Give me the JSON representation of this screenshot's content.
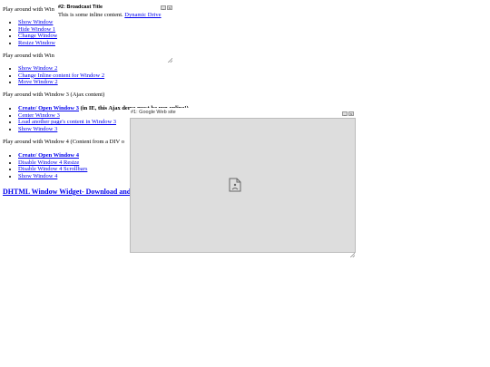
{
  "section1": {
    "text": "Play around with Win",
    "links": [
      "Show Window",
      "Hide Window 1",
      "Change Window",
      "Resize Window"
    ]
  },
  "section2": {
    "text": "Play around with Win",
    "links": [
      "Show Window 2",
      "Change Inline content for Window 2",
      "Move Window 2"
    ]
  },
  "section3": {
    "text": "Play around with Window 3 (Ajax content)",
    "first_link": "Create/ Open Window 3",
    "first_suffix": " (in IE, this Ajax demo must be run online!)",
    "links": [
      "Center Window 3",
      "Load another page's content in Window 3",
      "Show Window 3"
    ]
  },
  "section4": {
    "text": "Play around with Window 4 (Content from a DIV o",
    "links": [
      "Create/ Open Window 4",
      "Disable Window 4 Resize",
      "Disable Window 4 Scrollbars",
      "Show Window 4"
    ]
  },
  "footer_heading": "DHTML Window Widget- Download and",
  "window2": {
    "title": "#2: Broadcast Title",
    "body_text": "This is some inline content.",
    "body_link": "Dynamic Drive"
  },
  "window1": {
    "title": "#1: Google Web site"
  },
  "icons": {
    "minimize": "minimize-icon",
    "close": "close-icon",
    "resize": "resize-grip-icon",
    "broken_page": "broken-page-icon"
  },
  "colors": {
    "link": "#0000ee",
    "frame_bg": "#dddddd"
  }
}
